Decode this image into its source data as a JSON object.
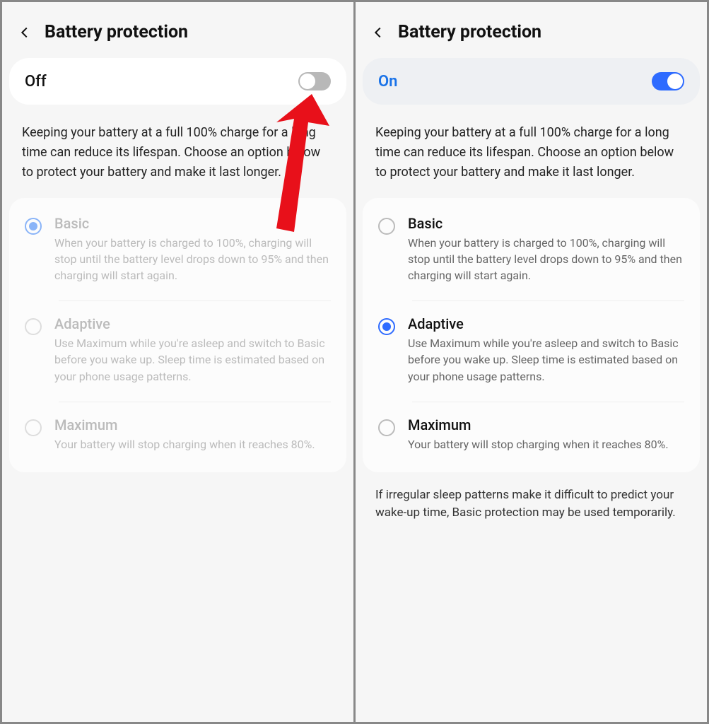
{
  "left": {
    "title": "Battery protection",
    "toggle": {
      "state": "off",
      "label": "Off"
    },
    "description": "Keeping your battery at a full 100% charge for a long time can reduce its lifespan. Choose an option below to protect your battery and make it last longer.",
    "options": [
      {
        "title": "Basic",
        "desc": "When your battery is charged to 100%, charging will stop until the battery level drops down to 95% and then charging will start again.",
        "selected": true
      },
      {
        "title": "Adaptive",
        "desc": "Use Maximum while you're asleep and switch to Basic before you wake up. Sleep time is estimated based on your phone usage patterns.",
        "selected": false
      },
      {
        "title": "Maximum",
        "desc": "Your battery will stop charging when it reaches 80%.",
        "selected": false
      }
    ]
  },
  "right": {
    "title": "Battery protection",
    "toggle": {
      "state": "on",
      "label": "On"
    },
    "description": "Keeping your battery at a full 100% charge for a long time can reduce its lifespan. Choose an option below to protect your battery and make it last longer.",
    "options": [
      {
        "title": "Basic",
        "desc": "When your battery is charged to 100%, charging will stop until the battery level drops down to 95% and then charging will start again.",
        "selected": false
      },
      {
        "title": "Adaptive",
        "desc": "Use Maximum while you're asleep and switch to Basic before you wake up. Sleep time is estimated based on your phone usage patterns.",
        "selected": true
      },
      {
        "title": "Maximum",
        "desc": "Your battery will stop charging when it reaches 80%.",
        "selected": false
      }
    ],
    "footnote": "If irregular sleep patterns make it difficult to predict your wake-up time, Basic protection may be used temporarily."
  },
  "annotation": {
    "type": "arrow",
    "color": "#e8101a"
  }
}
